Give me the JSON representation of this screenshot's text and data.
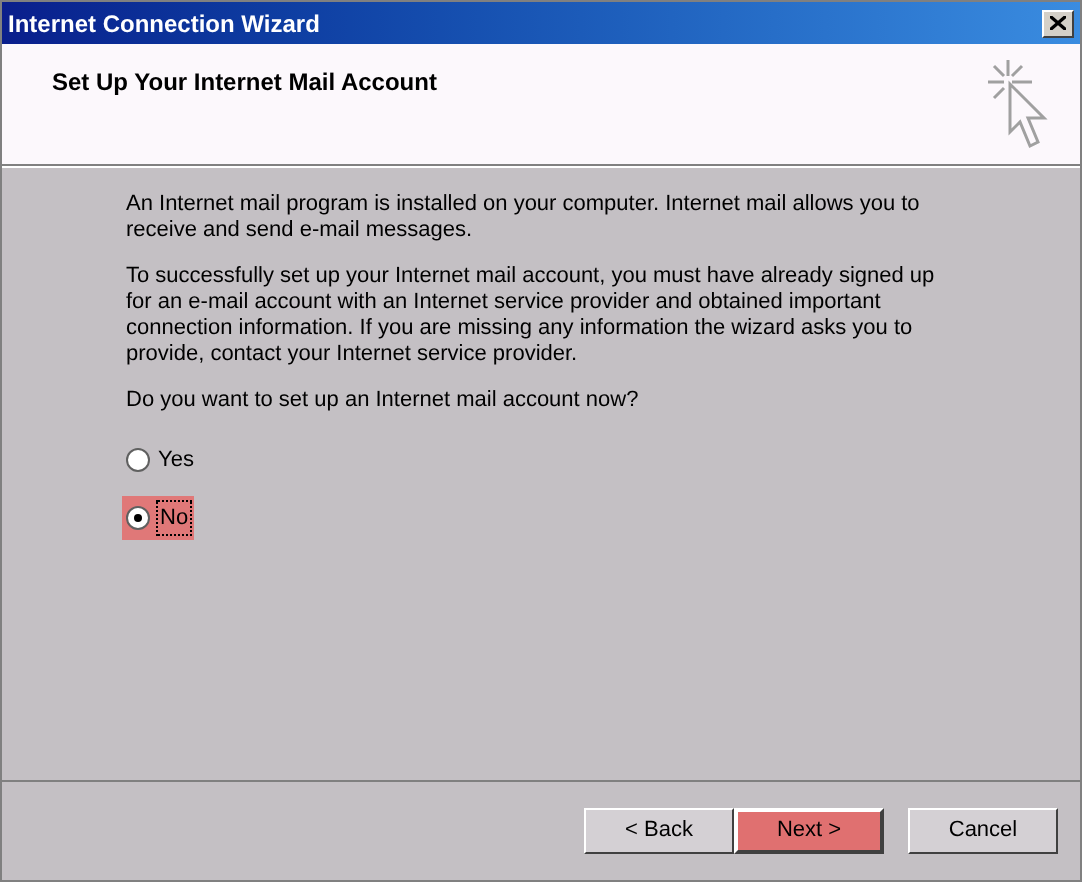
{
  "window": {
    "title": "Internet Connection Wizard"
  },
  "header": {
    "title": "Set Up Your Internet Mail Account"
  },
  "paragraphs": [
    "An Internet mail program is installed on your computer. Internet mail allows you to receive and send e-mail messages.",
    "To successfully set up your Internet mail account, you must have already signed up for an e-mail account with an Internet service provider and obtained important connection information. If you are missing any information the wizard asks you to provide, contact your Internet service provider.",
    "Do you want to set up an Internet mail account now?"
  ],
  "options": [
    {
      "label": "Yes",
      "selected": false,
      "highlighted": false
    },
    {
      "label": "No",
      "selected": true,
      "highlighted": true
    }
  ],
  "buttons": [
    {
      "label": "< Back",
      "highlighted": false
    },
    {
      "label": "Next >",
      "highlighted": true
    },
    {
      "label": "Cancel",
      "highlighted": false
    }
  ]
}
